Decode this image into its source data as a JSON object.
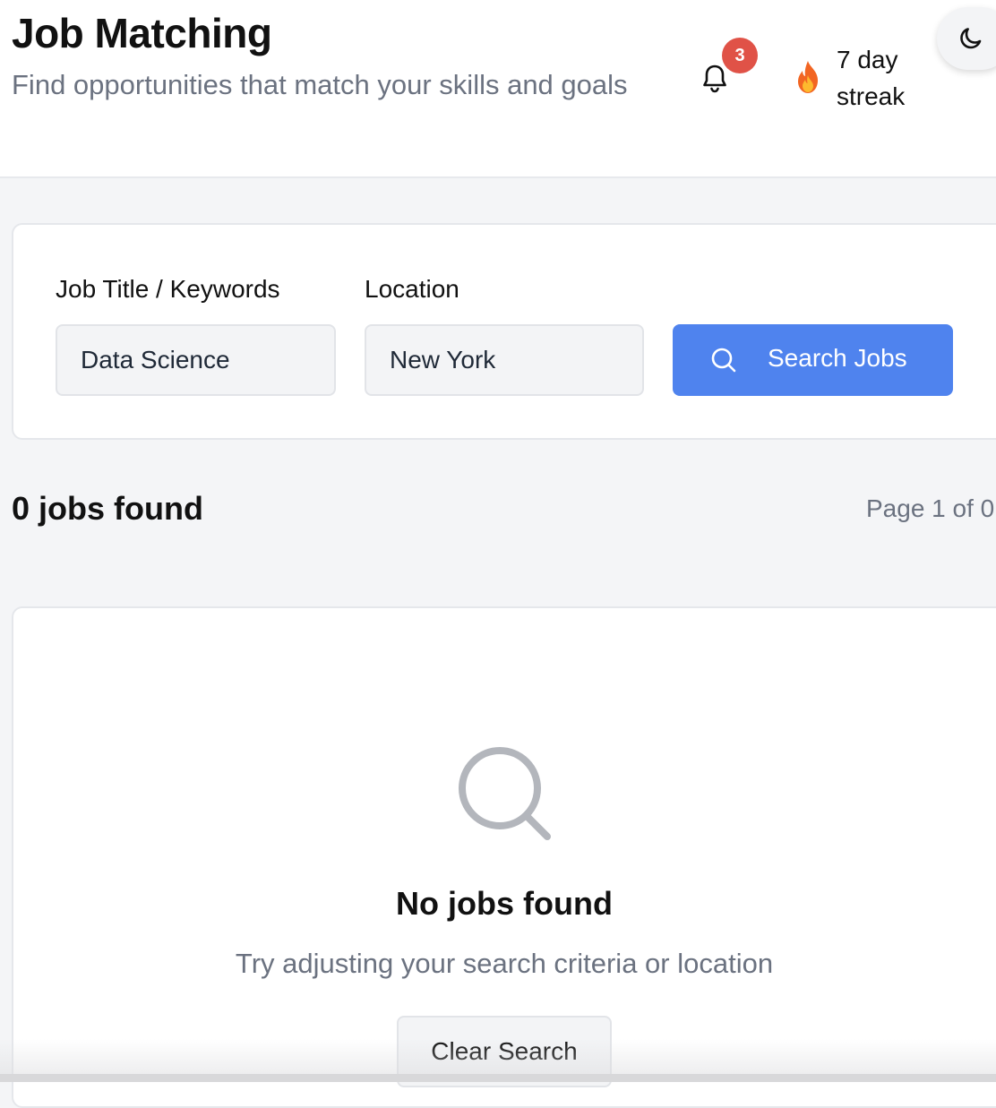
{
  "header": {
    "title": "Job Matching",
    "subtitle": "Find opportunities that match your skills and goals",
    "notifications": {
      "count": "3",
      "icon": "bell-icon"
    },
    "streak": {
      "icon": "flame-icon",
      "label": "7 day streak"
    },
    "theme_toggle": {
      "icon": "moon-icon"
    }
  },
  "search": {
    "keywords_label": "Job Title / Keywords",
    "keywords_value": "Data Science",
    "location_label": "Location",
    "location_value": "New York",
    "button_label": "Search Jobs",
    "button_icon": "search-icon"
  },
  "results": {
    "count_label": "0 jobs found",
    "page_info": "Page 1 of 0"
  },
  "empty_state": {
    "icon": "search-icon",
    "title": "No jobs found",
    "hint": "Try adjusting your search criteria or location",
    "clear_button": "Clear Search"
  },
  "colors": {
    "accent": "#4f83ee",
    "badge": "#e05247",
    "muted_text": "#6b7280",
    "background": "#f4f5f7"
  }
}
